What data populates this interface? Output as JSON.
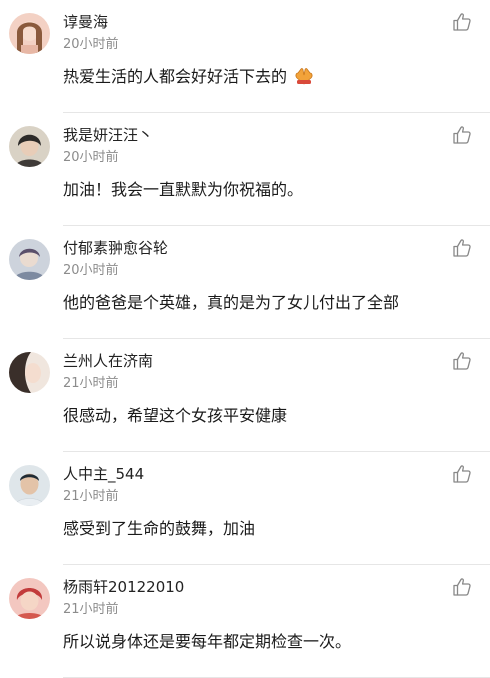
{
  "comments": [
    {
      "username": "谆曼海",
      "time": "20小时前",
      "content": "热爱生活的人都会好好活下去的",
      "has_emoji": true,
      "emoji_icon": "praying-hands-icon",
      "avatar_colors": [
        "#f3d1c4",
        "#8a5a3c"
      ]
    },
    {
      "username": "我是妍汪汪丶",
      "time": "20小时前",
      "content": "加油！我会一直默默为你祝福的。",
      "avatar_colors": [
        "#d9d2c5",
        "#2c2a28"
      ]
    },
    {
      "username": "付郁素翀愈谷轮",
      "time": "20小时前",
      "content": "他的爸爸是个英雄，真的是为了女儿付出了全部",
      "avatar_colors": [
        "#cdd3dc",
        "#5b4f6a"
      ]
    },
    {
      "username": "兰州人在济南",
      "time": "21小时前",
      "content": "很感动，希望这个女孩平安健康",
      "avatar_colors": [
        "#f0e6de",
        "#3a2f2a"
      ]
    },
    {
      "username": "人中主_544",
      "time": "21小时前",
      "content": "感受到了生命的鼓舞，加油",
      "avatar_colors": [
        "#dfe6ea",
        "#1f2a33"
      ]
    },
    {
      "username": "杨雨轩20122010",
      "time": "21小时前",
      "content": "所以说身体还是要每年都定期检查一次。",
      "avatar_colors": [
        "#f3c7c0",
        "#c23b3b"
      ]
    }
  ],
  "icons": {
    "like": "thumbs-up-icon",
    "avatar": "avatar-icon"
  },
  "colors": {
    "username": "#222222",
    "timestamp": "#8c8c8c",
    "divider": "#e6e6e6"
  }
}
